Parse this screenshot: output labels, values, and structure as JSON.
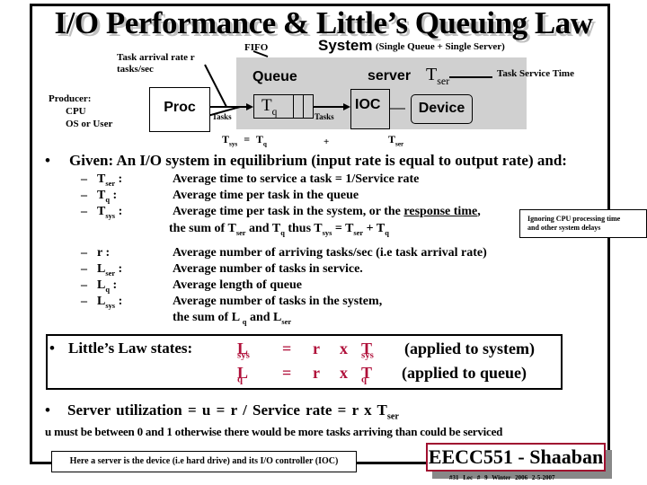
{
  "title": "I/O Performance & Little’s Queuing Law",
  "diagram": {
    "system_label": "System",
    "system_sub": "(Single Queue + Single Server)",
    "fifo": "FIFO",
    "arrival_line1": "Task arrival rate  r",
    "arrival_line2": "tasks/sec",
    "producer": [
      "Producer:",
      "CPU",
      "OS or User"
    ],
    "proc": "Proc",
    "queue": "Queue",
    "tq_main": "T",
    "tq_sub": "q",
    "tasks": "Tasks",
    "server": "server",
    "tser_main": "T",
    "tser_sub": "ser",
    "service_time": "Task Service Time",
    "ioc": "IOC",
    "device": "Device",
    "eq_tsys": "T",
    "eq_tsys_sub": "sys",
    "eq_equals": "=",
    "eq_tq": "T",
    "eq_tq_sub": "q",
    "eq_plus": "+",
    "eq_tser": "T",
    "eq_tser_sub": "ser"
  },
  "given": {
    "bullet": "•",
    "text": "Given:  An I/O system in equilibrium   (input rate is equal to output rate) and:"
  },
  "definitions": [
    {
      "dash": "–",
      "sym": "T",
      "sub": "ser",
      "colon": " :",
      "desc": "Average time to service a task = 1/Service rate"
    },
    {
      "dash": "–",
      "sym": "T",
      "sub": "q",
      "colon": " :",
      "desc": "Average time per task in the queue"
    },
    {
      "dash": "–",
      "sym": "T",
      "sub": "sys",
      "colon": " :",
      "desc_pre": "Average time per task in the system, or the ",
      "desc_link": "response time",
      "desc_post": ","
    },
    {
      "desc_cont": "the sum of  T",
      "c1": "ser",
      "c2": "  and  T",
      "c3": "q",
      "c4": "  thus  T",
      "c5": "sys",
      "c6": "  =  T",
      "c7": "ser",
      "c8": "  +  T",
      "c9": "q"
    },
    {
      "dash": "–",
      "sym": "r",
      "sub": "",
      "colon": " :",
      "desc": "Average number of arriving tasks/sec   (i.e  task arrival rate)"
    },
    {
      "dash": "–",
      "sym": "L",
      "sub": "ser",
      "colon": " :",
      "desc": "Average number of tasks in service."
    },
    {
      "dash": "–",
      "sym": "L",
      "sub": "q",
      "colon": " :",
      "desc": "Average length of queue"
    },
    {
      "dash": "–",
      "sym": "L",
      "sub": "sys",
      "colon": " :",
      "desc": "Average number of tasks in the system,"
    },
    {
      "desc_cont2": "the sum of  L ",
      "d1": "q",
      "d2": " and L",
      "d3": "ser"
    }
  ],
  "note": {
    "line1": "Ignoring CPU processing time",
    "line2": "and other system delays"
  },
  "little": {
    "bullet": "•",
    "label": "Little’s Law states:",
    "rows": [
      {
        "lhs": "L",
        "lhs_sub": "sys",
        "eq": "=",
        "r": "r",
        "x": "x",
        "t": "T",
        "t_sub": "sys",
        "note": "(applied to system)"
      },
      {
        "lhs": "L",
        "lhs_sub": "q",
        "eq": "=",
        "r": "r",
        "x": "x",
        "t": "T",
        "t_sub": "q",
        "note": "(applied to queue)"
      }
    ]
  },
  "utilization": {
    "bullet": "•",
    "text": "Server utilization  =  u =  r  /  Service rate  =    r  x  T",
    "sub": "ser",
    "constraint": "u  must be between  0  and  1  otherwise there would be more tasks arriving than could be serviced"
  },
  "server_note": "Here a server is the device (i.e hard drive) and its I/O controller (IOC)",
  "badge": "EECC551 - Shaaban",
  "footer": "#31   Lec # 9   Winter 2006  2-5-2007",
  "colors": {
    "accent_red": "#b0103a",
    "system_gray": "#d0d0d0"
  }
}
